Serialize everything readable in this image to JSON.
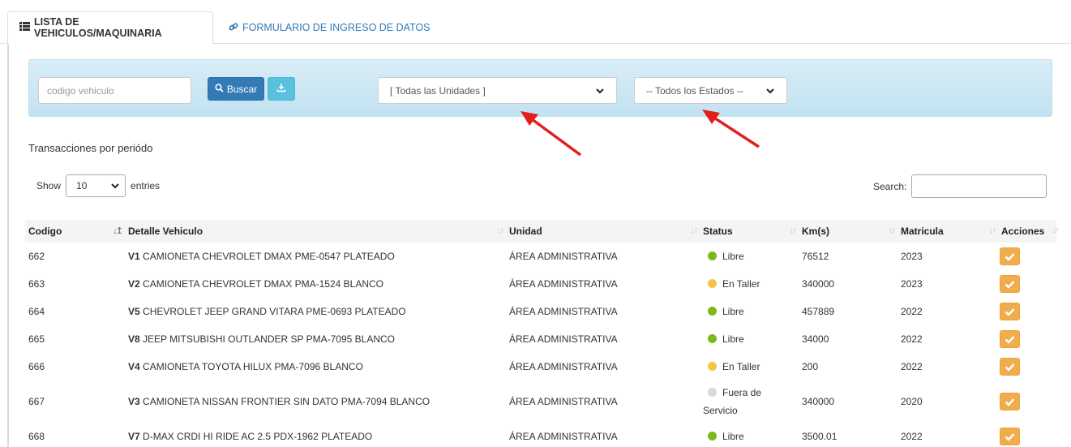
{
  "tabs": [
    {
      "label": "LISTA DE VEHICULOS/MAQUINARIA",
      "icon": "list-icon",
      "active": true
    },
    {
      "label": "FORMULARIO DE INGRESO DE DATOS",
      "icon": "link-icon",
      "active": false
    }
  ],
  "filters": {
    "code_placeholder": "codigo vehiculo",
    "search_button": "Buscar",
    "download_icon": "download-icon",
    "unidades_selected": "[ Todas las Unidades ]",
    "estados_selected": "-- Todos los Estados --",
    "bar_color": "#d9edf7"
  },
  "section_title": "Transacciones por periódo",
  "datatable": {
    "show_label": "Show",
    "entries_value": "10",
    "entries_label": "entries",
    "search_label": "Search:"
  },
  "table": {
    "headers": [
      "Codigo",
      "Detalle Vehiculo",
      "Unidad",
      "Status",
      "Km(s)",
      "Matricula",
      "Acciones"
    ],
    "rows": [
      {
        "codigo": "662",
        "v": "V1",
        "detalle": "CAMIONETA CHEVROLET DMAX PME-0547 PLATEADO",
        "unidad": "ÁREA ADMINISTRATIVA",
        "status": "Libre",
        "status_color": "#7ab91e",
        "km": "76512",
        "matricula": "2023"
      },
      {
        "codigo": "663",
        "v": "V2",
        "detalle": "CAMIONETA CHEVROLET DMAX PMA-1524 BLANCO",
        "unidad": "ÁREA ADMINISTRATIVA",
        "status": "En Taller",
        "status_color": "#f5c542",
        "km": "340000",
        "matricula": "2023"
      },
      {
        "codigo": "664",
        "v": "V5",
        "detalle": "CHEVROLET JEEP GRAND VITARA PME-0693 PLATEADO",
        "unidad": "ÁREA ADMINISTRATIVA",
        "status": "Libre",
        "status_color": "#7ab91e",
        "km": "457889",
        "matricula": "2022"
      },
      {
        "codigo": "665",
        "v": "V8",
        "detalle": "JEEP MITSUBISHI OUTLANDER SP PMA-7095 BLANCO",
        "unidad": "ÁREA ADMINISTRATIVA",
        "status": "Libre",
        "status_color": "#7ab91e",
        "km": "34000",
        "matricula": "2022"
      },
      {
        "codigo": "666",
        "v": "V4",
        "detalle": "CAMIONETA TOYOTA HILUX PMA-7096 BLANCO",
        "unidad": "ÁREA ADMINISTRATIVA",
        "status": "En Taller",
        "status_color": "#f5c542",
        "km": "200",
        "matricula": "2022"
      },
      {
        "codigo": "667",
        "v": "V3",
        "detalle": "CAMIONETA NISSAN FRONTIER SIN DATO PMA-7094 BLANCO",
        "unidad": "ÁREA ADMINISTRATIVA",
        "status": "Fuera de Servicio",
        "status_color": "#d9d9d9",
        "km": "340000",
        "matricula": "2020"
      },
      {
        "codigo": "668",
        "v": "V7",
        "detalle": "D-MAX CRDI HI RIDE AC 2.5 PDX-1962 PLATEADO",
        "unidad": "ÁREA ADMINISTRATIVA",
        "status": "Libre",
        "status_color": "#7ab91e",
        "km": "3500.01",
        "matricula": "2022"
      }
    ]
  },
  "colors": {
    "primary": "#337ab7",
    "info": "#5bc0de",
    "warning": "#f0ad4e",
    "annotation_arrow": "#e0201c"
  }
}
